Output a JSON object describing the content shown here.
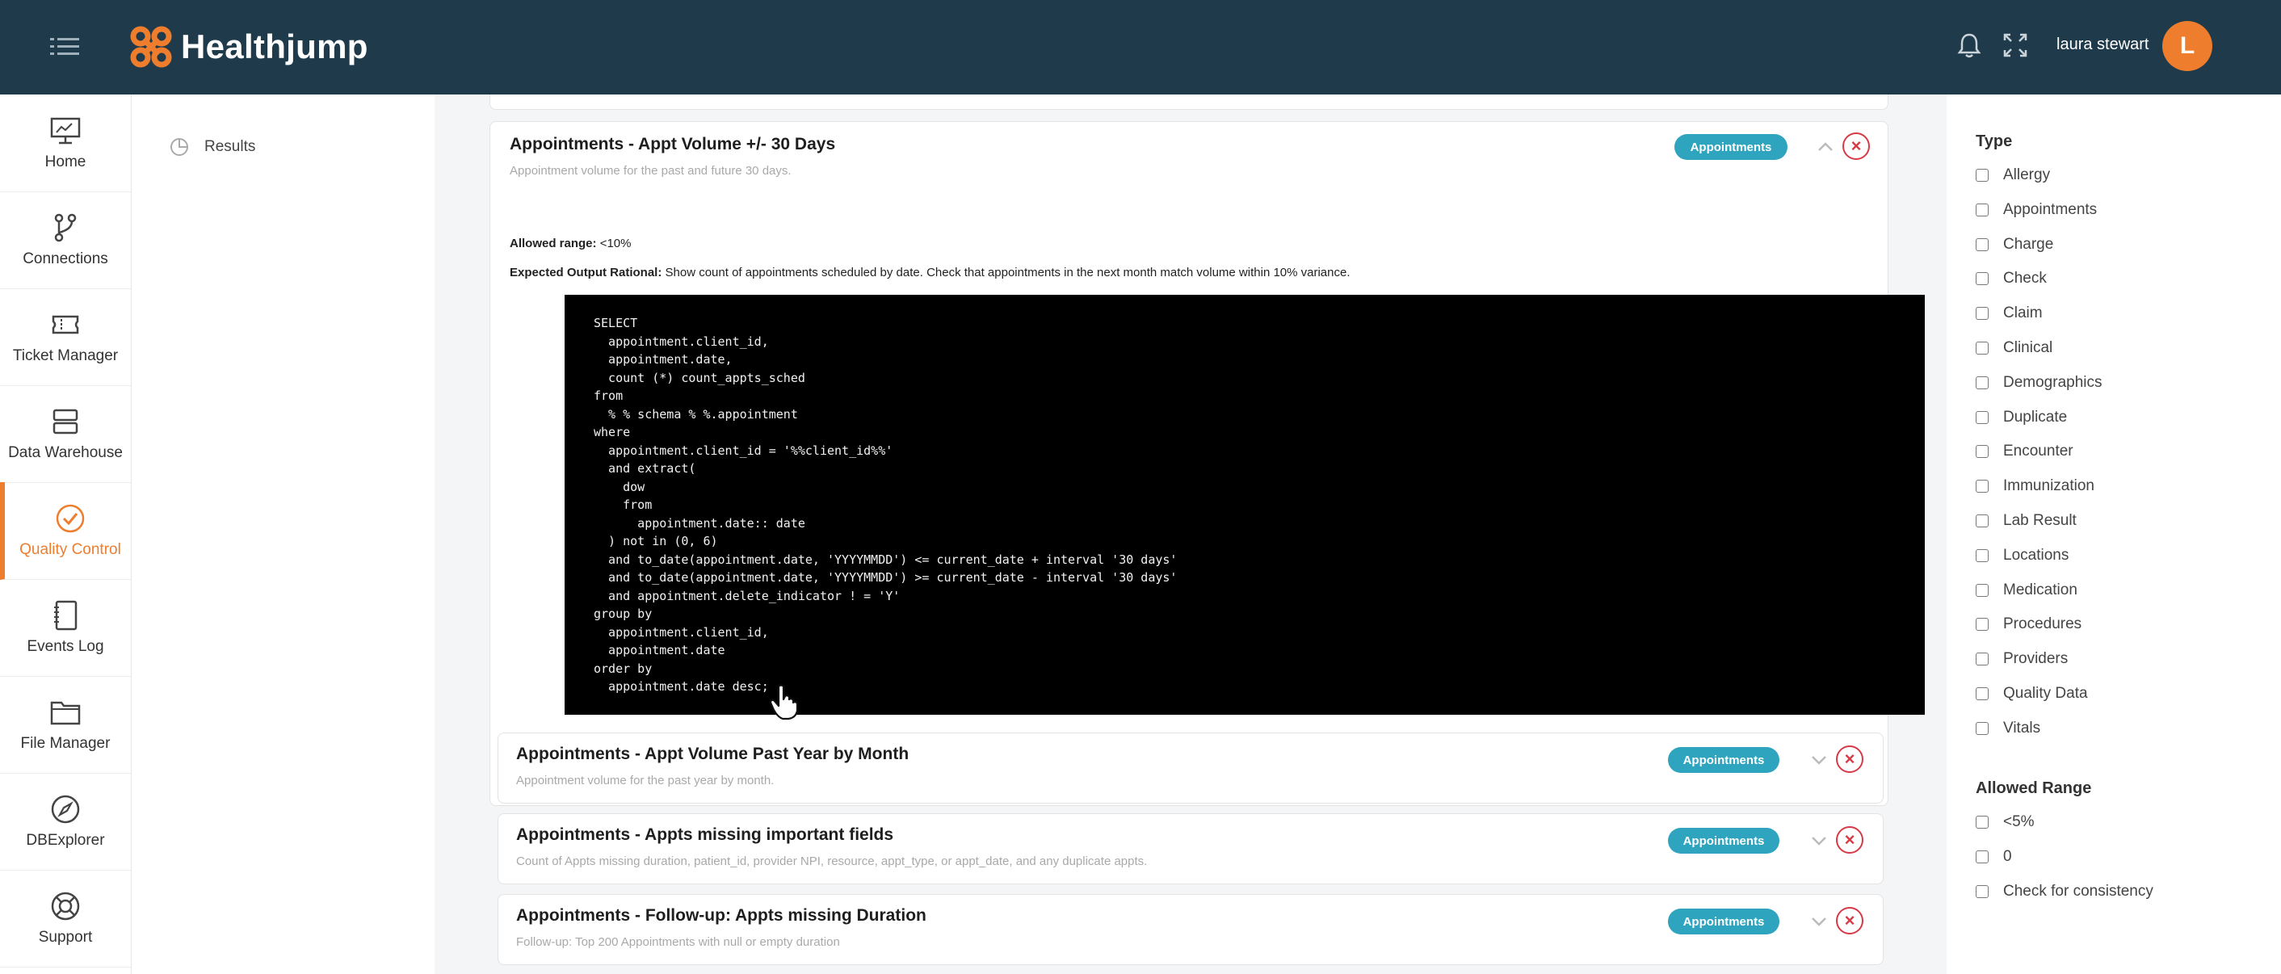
{
  "app": {
    "name": "Healthjump",
    "user": "laura stewart",
    "avatar_initial": "L",
    "colors": {
      "header": "#1f3a4a",
      "accent": "#ee7d2d",
      "tag": "#2fa4bf",
      "remove": "#d83a45"
    }
  },
  "nav": {
    "items": [
      {
        "label": "Home",
        "icon": "home-dashboard-icon"
      },
      {
        "label": "Connections",
        "icon": "git-branch-icon"
      },
      {
        "label": "Ticket Manager",
        "icon": "ticket-icon"
      },
      {
        "label": "Data Warehouse",
        "icon": "database-icon"
      },
      {
        "label": "Quality Control",
        "icon": "check-circle-icon",
        "active": true
      },
      {
        "label": "Events Log",
        "icon": "notebook-icon"
      },
      {
        "label": "File Manager",
        "icon": "folder-icon"
      },
      {
        "label": "DBExplorer",
        "icon": "compass-icon"
      },
      {
        "label": "Support",
        "icon": "lifebuoy-icon"
      }
    ]
  },
  "subnav": {
    "results_label": "Results"
  },
  "cards": [
    {
      "title": "Appointments - Appt Volume +/- 30 Days",
      "description": "Appointment volume for the past and future 30 days.",
      "tag": "Appointments",
      "expanded": true,
      "allowed_range_label": "Allowed range:",
      "allowed_range_value": "<10%",
      "rational_label": "Expected Output Rational:",
      "rational_text": "Show count of appointments scheduled by date. Check that appointments in the next month match volume within 10% variance.",
      "sql": "SELECT\n  appointment.client_id,\n  appointment.date,\n  count (*) count_appts_sched\nfrom\n  % % schema % %.appointment\nwhere\n  appointment.client_id = '%%client_id%%'\n  and extract(\n    dow\n    from\n      appointment.date:: date\n  ) not in (0, 6)\n  and to_date(appointment.date, 'YYYYMMDD') <= current_date + interval '30 days'\n  and to_date(appointment.date, 'YYYYMMDD') >= current_date - interval '30 days'\n  and appointment.delete_indicator ! = 'Y'\ngroup by\n  appointment.client_id,\n  appointment.date\norder by\n  appointment.date desc;"
    },
    {
      "title": "Appointments - Appt Volume Past Year by Month",
      "description": "Appointment volume for the past year by month.",
      "tag": "Appointments",
      "expanded": false
    },
    {
      "title": "Appointments - Appts missing important fields",
      "description": "Count of Appts missing duration, patient_id, provider NPI, resource, appt_type, or appt_date, and any duplicate appts.",
      "tag": "Appointments",
      "expanded": false
    },
    {
      "title": "Appointments - Follow-up: Appts missing Duration",
      "description": "Follow-up: Top 200 Appointments with null or empty duration",
      "tag": "Appointments",
      "expanded": false
    }
  ],
  "filters": {
    "type_title": "Type",
    "types": [
      "Allergy",
      "Appointments",
      "Charge",
      "Check",
      "Claim",
      "Clinical",
      "Demographics",
      "Duplicate",
      "Encounter",
      "Immunization",
      "Lab Result",
      "Locations",
      "Medication",
      "Procedures",
      "Providers",
      "Quality Data",
      "Vitals"
    ],
    "range_title": "Allowed Range",
    "ranges": [
      "<5%",
      "0",
      "Check for consistency"
    ]
  }
}
